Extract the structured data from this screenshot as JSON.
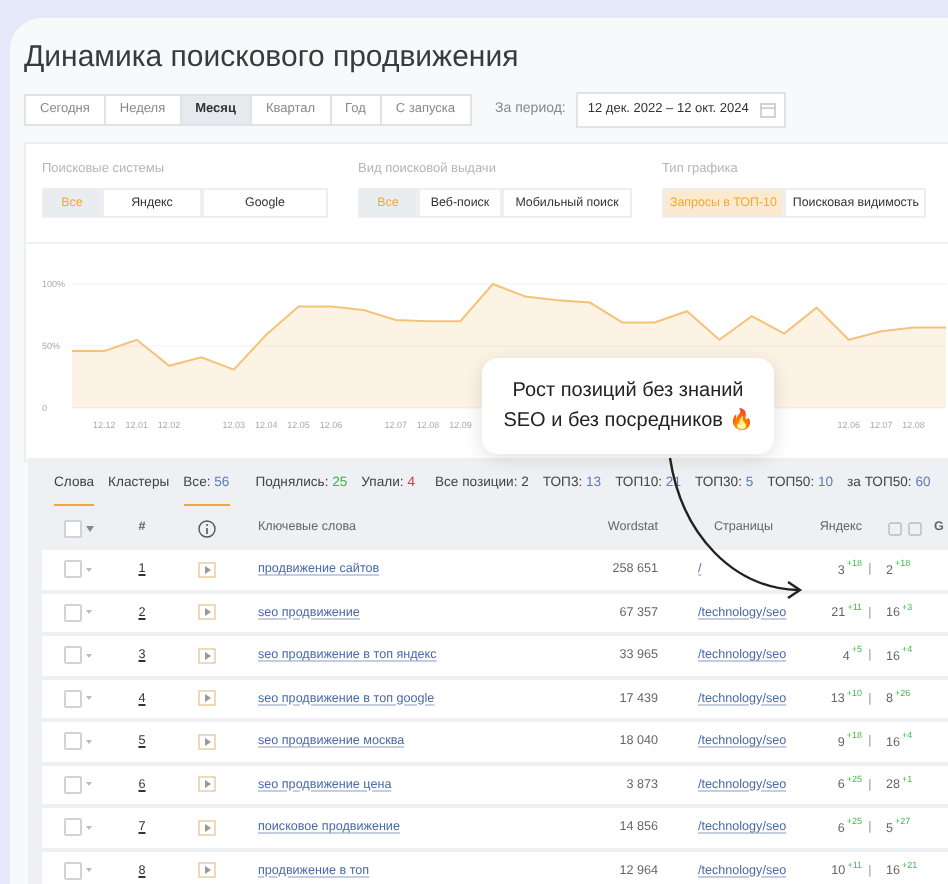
{
  "title": "Динамика поискового продвижения",
  "periods": [
    {
      "label": "Сегодня",
      "selected": false
    },
    {
      "label": "Неделя",
      "selected": false
    },
    {
      "label": "Месяц",
      "selected": true
    },
    {
      "label": "Квартал",
      "selected": false
    },
    {
      "label": "Год",
      "selected": false
    },
    {
      "label": "С запуска",
      "selected": false
    }
  ],
  "period_label": "За период:",
  "date_range": "12 дек. 2022 – 12 окт. 2024",
  "filter_groups": [
    {
      "label": "Поисковые системы",
      "options": [
        {
          "label": "Все",
          "selected": true
        },
        {
          "label": "Яндекс",
          "selected": false
        },
        {
          "label": "Google",
          "selected": false
        }
      ]
    },
    {
      "label": "Вид поисковой выдачи",
      "options": [
        {
          "label": "Все",
          "selected": true
        },
        {
          "label": "Веб-поиск",
          "selected": false
        },
        {
          "label": "Мобильный поиск",
          "selected": false
        }
      ]
    },
    {
      "label": "Тип графика",
      "options": [
        {
          "label": "Запросы в ТОП-10",
          "selected": true
        },
        {
          "label": "Поисковая видимость",
          "selected": false
        }
      ]
    }
  ],
  "chart_data": {
    "type": "area",
    "categories": [
      null,
      "12.12",
      "12.01",
      "12.02",
      null,
      "12.03",
      "12.04",
      "12.05",
      "12.06",
      null,
      "12.07",
      "12.08",
      "12.09",
      null,
      null,
      null,
      null,
      null,
      null,
      null,
      null,
      null,
      null,
      null,
      "12.06",
      "12.07",
      "12.08",
      null
    ],
    "series": [
      {
        "color": "#f5c27a",
        "values": [
          46,
          46,
          55,
          34,
          41,
          31,
          59,
          82,
          82,
          79,
          71,
          70,
          70,
          100,
          90,
          87,
          85,
          69,
          69,
          78,
          55,
          74,
          60,
          81,
          55,
          62,
          65,
          65
        ]
      }
    ],
    "ylim": [
      0,
      100
    ],
    "yticks": [
      {
        "value": 0,
        "label": "0"
      },
      {
        "value": 50,
        "label": "50%"
      },
      {
        "value": 100,
        "label": "100%"
      }
    ]
  },
  "callout": "Рост позиций без знаний SEO и без посредников 🔥",
  "views": [
    {
      "label": "Слова",
      "selected": true
    },
    {
      "label": "Кластеры",
      "selected": false
    }
  ],
  "stats": [
    {
      "label": "Все:",
      "value": "56",
      "kind": "count",
      "selected": true
    },
    {
      "label": "Поднялись:",
      "value": "25",
      "kind": "up",
      "selected": false
    },
    {
      "label": "Упали:",
      "value": "4",
      "kind": "down",
      "selected": false
    },
    {
      "label": "Все позиции:",
      "value": "2",
      "kind": "plain",
      "selected": false
    },
    {
      "label": "ТОП3:",
      "value": "13",
      "kind": "count",
      "selected": false
    },
    {
      "label": "ТОП10:",
      "value": "21",
      "kind": "count",
      "selected": false
    },
    {
      "label": "ТОП30:",
      "value": "5",
      "kind": "count",
      "selected": false
    },
    {
      "label": "ТОП50:",
      "value": "10",
      "kind": "count",
      "selected": false
    },
    {
      "label": "за ТОП50:",
      "value": "60",
      "kind": "count",
      "selected": false
    }
  ],
  "select_all_checked": false,
  "columns": {
    "number": "#",
    "keywords": "Ключевые слова",
    "wordstat": "Wordstat",
    "pages": "Страницы",
    "yandex": "Яндекс",
    "google": "G"
  },
  "rows": [
    {
      "checked": false,
      "number": "1",
      "keyword": "продвижение сайтов",
      "wordstat": "258 651",
      "page": "/",
      "yandex": "3",
      "yandex_delta": "+18",
      "separator": "|",
      "google": "2",
      "google_delta": "+18"
    },
    {
      "checked": false,
      "number": "2",
      "keyword": "seo продвижение",
      "wordstat": "67 357",
      "page": "/technology/seo",
      "yandex": "21",
      "yandex_delta": "+11",
      "separator": "|",
      "google": "16",
      "google_delta": "+3"
    },
    {
      "checked": false,
      "number": "3",
      "keyword": "seo продвижение в топ яндекс",
      "wordstat": "33 965",
      "page": "/technology/seo",
      "yandex": "4",
      "yandex_delta": "+5",
      "separator": "|",
      "google": "16",
      "google_delta": "+4"
    },
    {
      "checked": false,
      "number": "4",
      "keyword": "seo продвижение в топ google",
      "wordstat": "17 439",
      "page": "/technology/seo",
      "yandex": "13",
      "yandex_delta": "+10",
      "separator": "|",
      "google": "8",
      "google_delta": "+26"
    },
    {
      "checked": false,
      "number": "5",
      "keyword": "seo продвижение москва",
      "wordstat": "18 040",
      "page": "/technology/seo",
      "yandex": "9",
      "yandex_delta": "+18",
      "separator": "|",
      "google": "16",
      "google_delta": "+4"
    },
    {
      "checked": false,
      "number": "6",
      "keyword": "seo продвижение цена",
      "wordstat": "3 873",
      "page": "/technology/seo",
      "yandex": "6",
      "yandex_delta": "+25",
      "separator": "|",
      "google": "28",
      "google_delta": "+1"
    },
    {
      "checked": false,
      "number": "7",
      "keyword": "поисковое продвижение",
      "wordstat": "14 856",
      "page": "/technology/seo",
      "yandex": "6",
      "yandex_delta": "+25",
      "separator": "|",
      "google": "5",
      "google_delta": "+27"
    },
    {
      "checked": false,
      "number": "8",
      "keyword": "продвижение в топ",
      "wordstat": "12 964",
      "page": "/technology/seo",
      "yandex": "10",
      "yandex_delta": "+11",
      "separator": "|",
      "google": "16",
      "google_delta": "+21"
    }
  ]
}
